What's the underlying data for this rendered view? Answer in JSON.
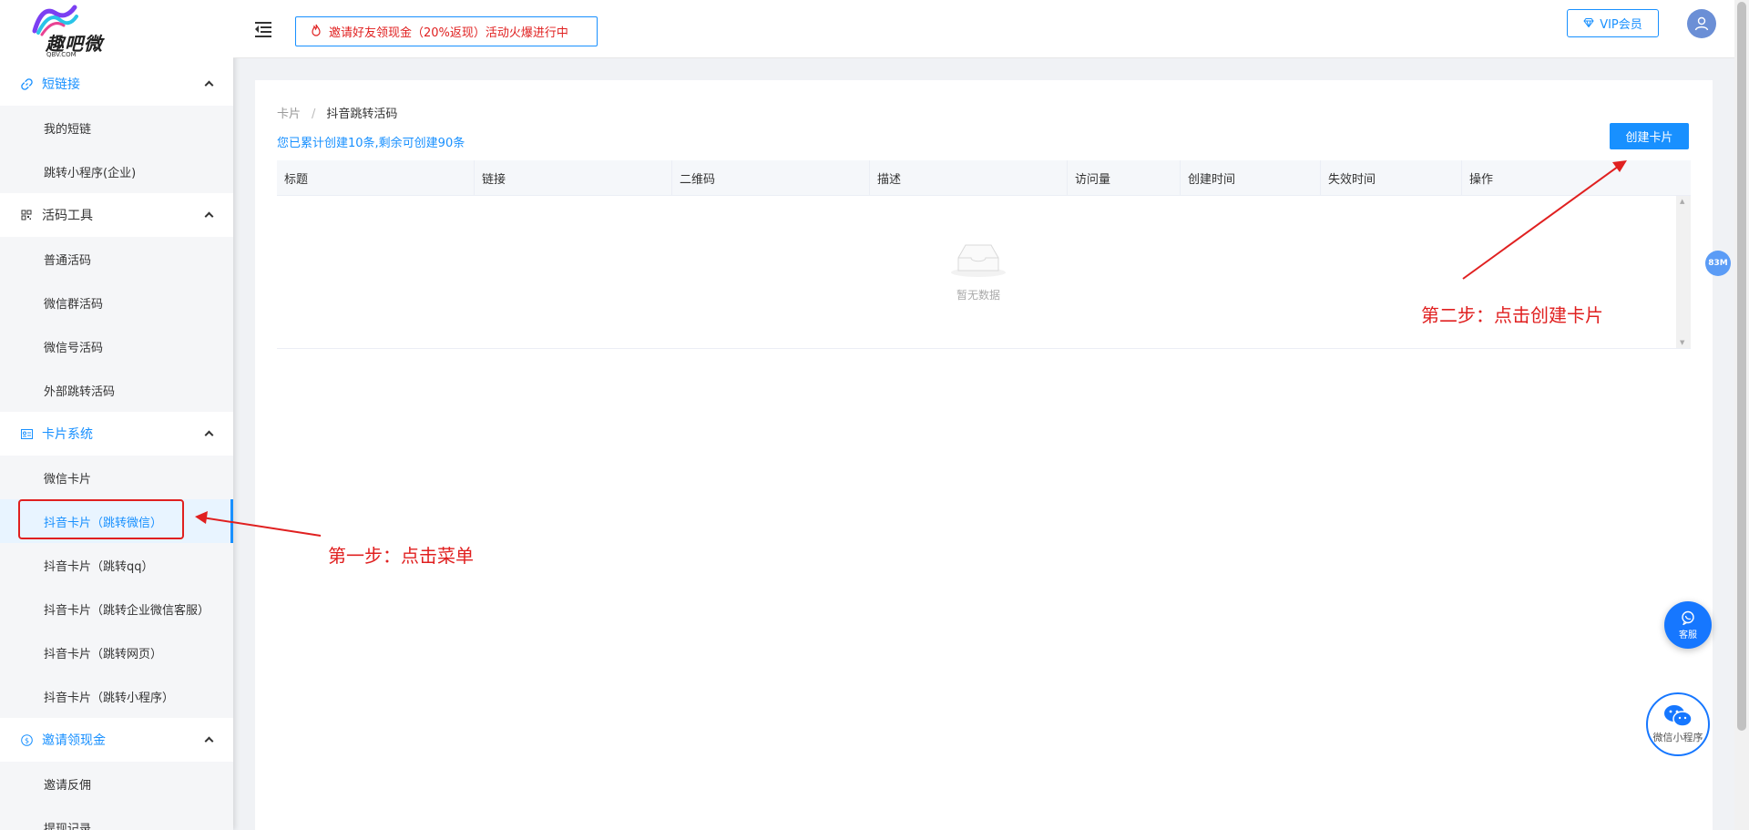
{
  "logo": {
    "text": "趣吧微",
    "sub": "QBV.COM"
  },
  "sidebar": {
    "groups": [
      {
        "label": "短链接",
        "icon": "link-icon",
        "items": [
          "我的短链",
          "跳转小程序(企业)"
        ]
      },
      {
        "label": "活码工具",
        "icon": "qrcode-icon",
        "items": [
          "普通活码",
          "微信群活码",
          "微信号活码",
          "外部跳转活码"
        ]
      },
      {
        "label": "卡片系统",
        "icon": "card-icon",
        "items": [
          "微信卡片",
          "抖音卡片（跳转微信）",
          "抖音卡片（跳转qq）",
          "抖音卡片（跳转企业微信客服）",
          "抖音卡片（跳转网页）",
          "抖音卡片（跳转小程序）"
        ]
      },
      {
        "label": "邀请领现金",
        "icon": "dollar-icon",
        "items": [
          "邀请反佣",
          "提现记录"
        ]
      }
    ],
    "active_item": "抖音卡片（跳转微信）"
  },
  "header": {
    "promo_text": "邀请好友领现金（20%返现）活动火爆进行中",
    "vip_label": "VIP会员"
  },
  "main": {
    "breadcrumb": [
      "卡片",
      "抖音跳转活码"
    ],
    "stat_text": "您已累计创建10条,剩余可创建90条",
    "create_button": "创建卡片",
    "table": {
      "columns": [
        "标题",
        "链接",
        "二维码",
        "描述",
        "访问量",
        "创建时间",
        "失效时间",
        "操作"
      ],
      "empty_text": "暂无数据"
    }
  },
  "annotations": {
    "step1": "第一步：点击菜单",
    "step2": "第二步：点击创建卡片"
  },
  "floating": {
    "memory": "83M",
    "service_label": "客服",
    "miniapp_label": "微信小程序"
  },
  "colors": {
    "accent": "#1890ff",
    "annotation": "#e02020",
    "promo_text": "#e02020"
  }
}
